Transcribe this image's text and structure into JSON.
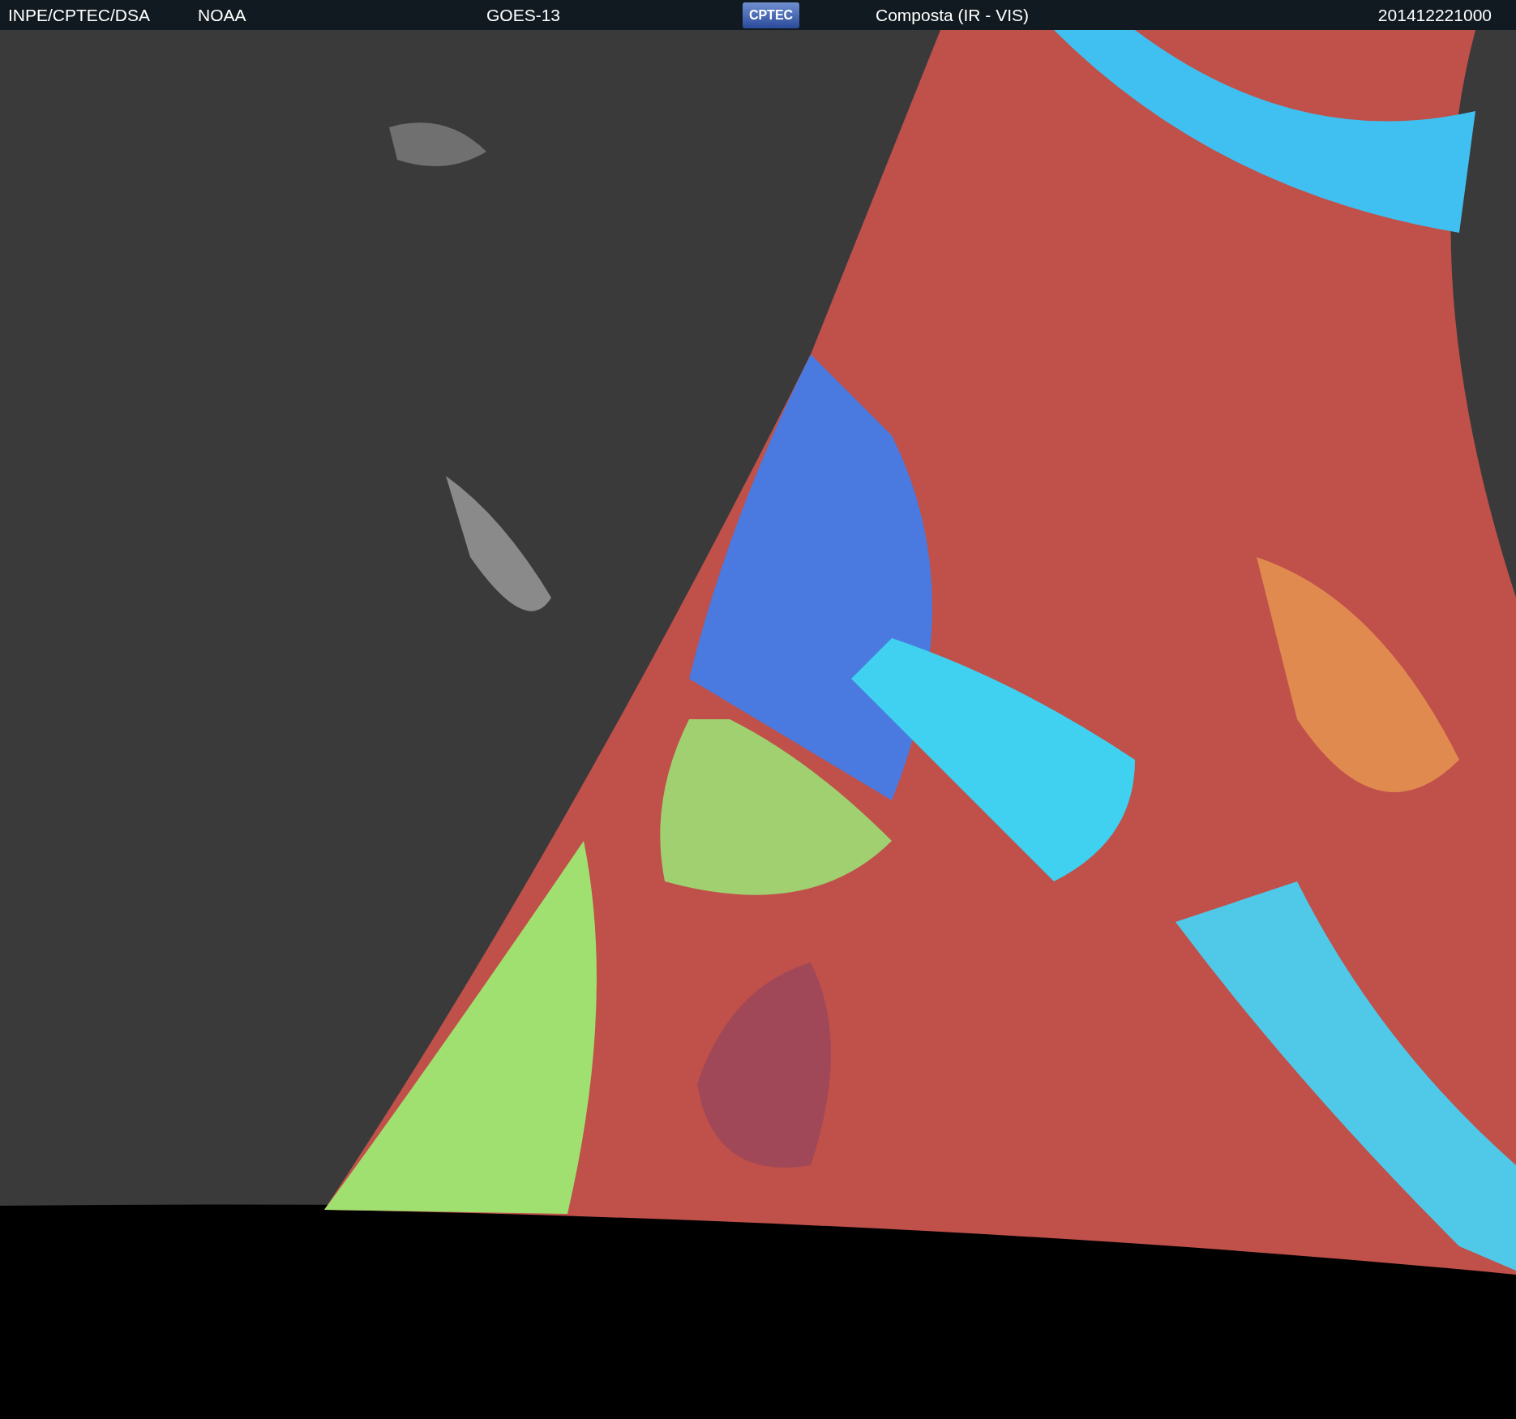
{
  "header": {
    "source": "INPE/CPTEC/DSA",
    "agency": "NOAA",
    "satellite": "GOES-13",
    "logo": "CPTEC",
    "product": "Composta (IR - VIS)",
    "timestamp": "201412221000"
  }
}
